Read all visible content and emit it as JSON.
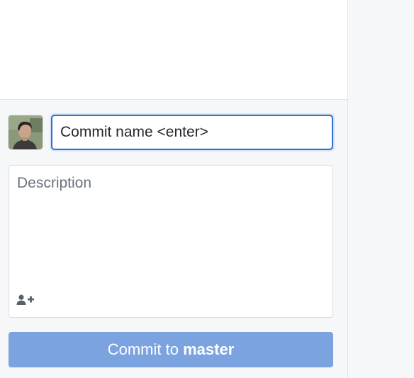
{
  "commit": {
    "summary_value": "Commit name <enter>",
    "description_placeholder": "Description",
    "button_prefix": "Commit to ",
    "button_branch": "master"
  },
  "icons": {
    "avatar": "user-avatar-photo",
    "coauthor": "add-coauthor-icon"
  },
  "colors": {
    "focus_border": "#2f6fd6",
    "commit_button": "#7ba3e0",
    "panel_background": "#f6f7f9"
  }
}
